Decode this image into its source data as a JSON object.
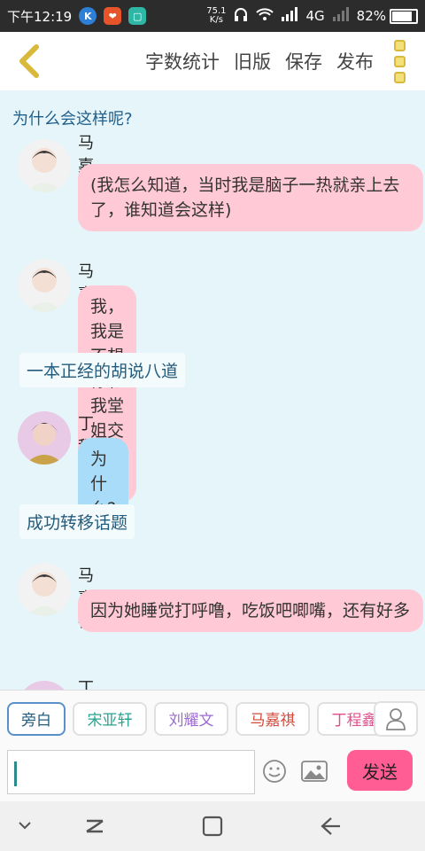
{
  "status_bar": {
    "time": "下午12:19",
    "speed_value": "75.1",
    "speed_unit": "K/s",
    "network": "4G",
    "battery": "82%"
  },
  "header": {
    "actions": [
      "字数统计",
      "旧版",
      "保存",
      "发布"
    ]
  },
  "chat": {
    "topic": "为什么会这样呢?",
    "messages": [
      {
        "speaker": "马嘉祺",
        "text": "(我怎么知道，当时我是脑子一热就亲上去了，谁知道会这样)"
      },
      {
        "speaker": "马嘉祺",
        "text": "我，我是不想你和我堂姐交朋友的"
      },
      {
        "narration": "一本正经的胡说八道"
      },
      {
        "speaker": "丁程鑫",
        "text": "为什么?"
      },
      {
        "narration": "成功转移话题"
      },
      {
        "speaker": "马嘉祺",
        "text": "因为她睡觉打呼噜，吃饭吧唧嘴，还有好多"
      },
      {
        "speaker": "丁程鑫"
      }
    ]
  },
  "characters": [
    {
      "label": "旁白",
      "color": "#235c7d"
    },
    {
      "label": "宋亚轩",
      "color": "#2aa28f"
    },
    {
      "label": "刘耀文",
      "color": "#9b6ad1"
    },
    {
      "label": "马嘉祺",
      "color": "#d24a3a"
    },
    {
      "label": "丁程鑫",
      "color": "#e0508e"
    }
  ],
  "input": {
    "value": "",
    "send_label": "发送"
  },
  "colors": {
    "send": "#ff5d94",
    "bubble_pink": "#ffc9d6",
    "bubble_blue": "#a8dcf8"
  }
}
